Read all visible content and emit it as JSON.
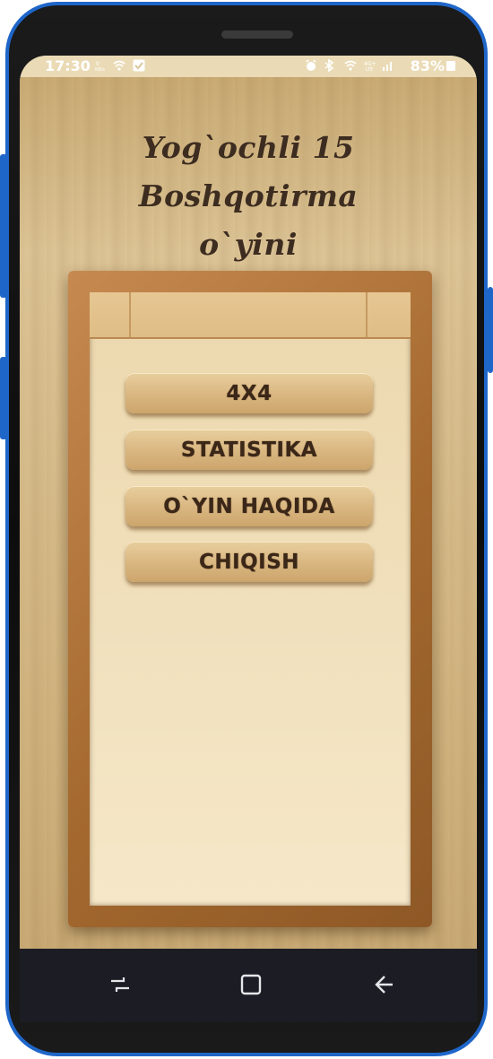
{
  "status_bar": {
    "time": "17:30",
    "battery": "83%",
    "icons": [
      "kbs-icon",
      "wifi-icon",
      "check-icon",
      "alarm-icon",
      "bluetooth-icon",
      "wifi-icon",
      "lte-icon",
      "signal-icon",
      "battery-icon"
    ]
  },
  "app": {
    "title_line1": "Yog`ochli 15 Boshqotirma",
    "title_line2": "o`yini"
  },
  "menu": {
    "items": [
      {
        "label": "4X4"
      },
      {
        "label": "STATISTIKA"
      },
      {
        "label": "O`YIN HAQIDA"
      },
      {
        "label": "CHIQISH"
      }
    ]
  },
  "nav_bar": {
    "icons": [
      "recent-apps-icon",
      "home-icon",
      "back-icon"
    ]
  },
  "colors": {
    "phone_accent": "#1f66c9",
    "wood_background": "#d6b985",
    "frame": "#a4692f",
    "text_dark": "#3b2718"
  }
}
